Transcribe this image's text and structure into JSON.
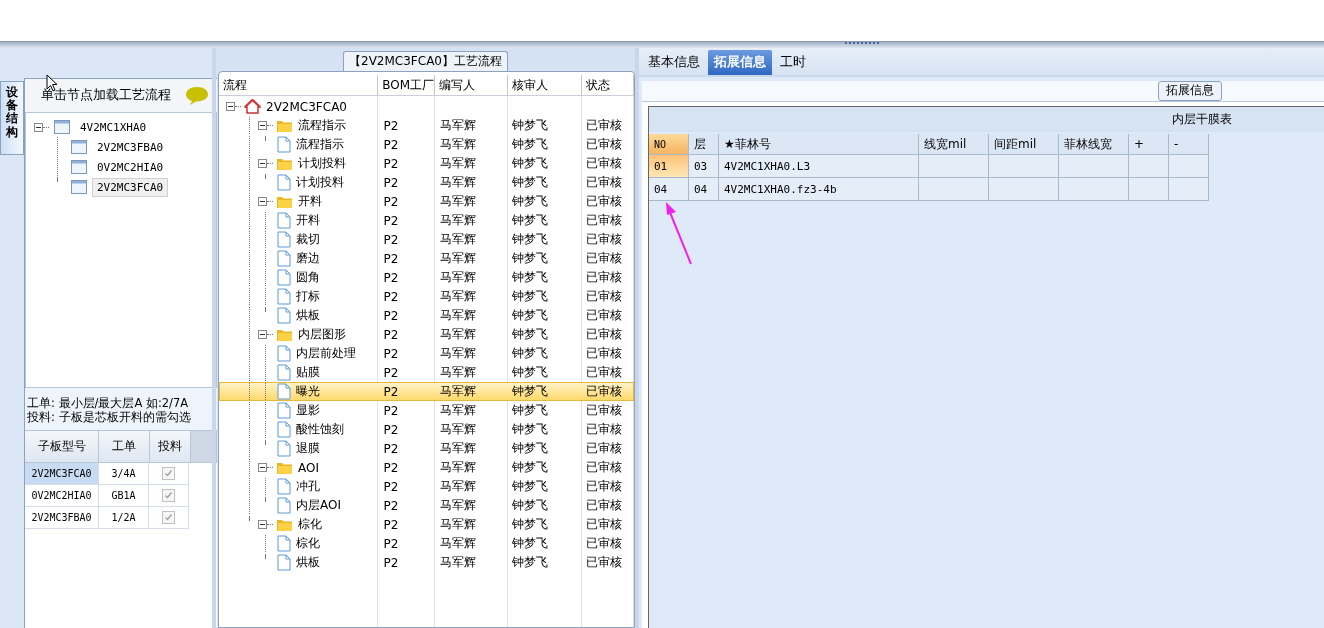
{
  "side_tab": {
    "label": "设备结构"
  },
  "left_panel": {
    "hint": "单击节点加载工艺流程",
    "tree": [
      {
        "label": "4V2MC1XHA0",
        "selected": false,
        "expanded": true,
        "children": [
          {
            "label": "2V2MC3FBA0",
            "selected": false
          },
          {
            "label": "0V2MC2HIA0",
            "selected": false
          },
          {
            "label": "2V2MC3FCA0",
            "selected": true
          }
        ]
      }
    ],
    "notes": [
      "工单: 最小层/最大层A 如:2/7A",
      "投料: 子板是芯板开料的需勾选"
    ],
    "grid": {
      "columns": [
        "子板型号",
        "工单",
        "投料"
      ],
      "rows": [
        {
          "model": "2V2MC3FCA0",
          "order": "3/4A",
          "checked": true,
          "selected": true
        },
        {
          "model": "0V2MC2HIA0",
          "order": "GB1A",
          "checked": true,
          "selected": false
        },
        {
          "model": "2V2MC3FBA0",
          "order": "1/2A",
          "checked": true,
          "selected": false
        }
      ]
    }
  },
  "flow_panel": {
    "title": "【2V2MC3FCA0】工艺流程",
    "columns": [
      "流程",
      "BOM工厂",
      "编写人",
      "核审人",
      "状态"
    ],
    "tree": [
      {
        "label": "2V2MC3FCA0",
        "kind": "root",
        "expanded": true,
        "children": [
          {
            "label": "流程指示",
            "kind": "folder",
            "expanded": true,
            "bom": "P2",
            "writer": "马军辉",
            "reviewer": "钟梦飞",
            "status": "已审核",
            "selected": false,
            "children": [
              {
                "label": "流程指示",
                "kind": "step",
                "bom": "P2",
                "writer": "马军辉",
                "reviewer": "钟梦飞",
                "status": "已审核",
                "selected": false
              }
            ]
          },
          {
            "label": "计划投料",
            "kind": "folder",
            "expanded": true,
            "bom": "P2",
            "writer": "马军辉",
            "reviewer": "钟梦飞",
            "status": "已审核",
            "selected": false,
            "children": [
              {
                "label": "计划投料",
                "kind": "step",
                "bom": "P2",
                "writer": "马军辉",
                "reviewer": "钟梦飞",
                "status": "已审核",
                "selected": false
              }
            ]
          },
          {
            "label": "开料",
            "kind": "folder",
            "expanded": true,
            "bom": "P2",
            "writer": "马军辉",
            "reviewer": "钟梦飞",
            "status": "已审核",
            "selected": false,
            "children": [
              {
                "label": "开料",
                "kind": "step",
                "bom": "P2",
                "writer": "马军辉",
                "reviewer": "钟梦飞",
                "status": "已审核",
                "selected": false
              },
              {
                "label": "裁切",
                "kind": "step",
                "bom": "P2",
                "writer": "马军辉",
                "reviewer": "钟梦飞",
                "status": "已审核",
                "selected": false
              },
              {
                "label": "磨边",
                "kind": "step",
                "bom": "P2",
                "writer": "马军辉",
                "reviewer": "钟梦飞",
                "status": "已审核",
                "selected": false
              },
              {
                "label": "圆角",
                "kind": "step",
                "bom": "P2",
                "writer": "马军辉",
                "reviewer": "钟梦飞",
                "status": "已审核",
                "selected": false
              },
              {
                "label": "打标",
                "kind": "step",
                "bom": "P2",
                "writer": "马军辉",
                "reviewer": "钟梦飞",
                "status": "已审核",
                "selected": false
              },
              {
                "label": "烘板",
                "kind": "step",
                "bom": "P2",
                "writer": "马军辉",
                "reviewer": "钟梦飞",
                "status": "已审核",
                "selected": false
              }
            ]
          },
          {
            "label": "内层图形",
            "kind": "folder",
            "expanded": true,
            "bom": "P2",
            "writer": "马军辉",
            "reviewer": "钟梦飞",
            "status": "已审核",
            "selected": false,
            "children": [
              {
                "label": "内层前处理",
                "kind": "step",
                "bom": "P2",
                "writer": "马军辉",
                "reviewer": "钟梦飞",
                "status": "已审核",
                "selected": false
              },
              {
                "label": "贴膜",
                "kind": "step",
                "bom": "P2",
                "writer": "马军辉",
                "reviewer": "钟梦飞",
                "status": "已审核",
                "selected": false
              },
              {
                "label": "曝光",
                "kind": "step",
                "bom": "P2",
                "writer": "马军辉",
                "reviewer": "钟梦飞",
                "status": "已审核",
                "selected": true
              },
              {
                "label": "显影",
                "kind": "step",
                "bom": "P2",
                "writer": "马军辉",
                "reviewer": "钟梦飞",
                "status": "已审核",
                "selected": false
              },
              {
                "label": "酸性蚀刻",
                "kind": "step",
                "bom": "P2",
                "writer": "马军辉",
                "reviewer": "钟梦飞",
                "status": "已审核",
                "selected": false
              },
              {
                "label": "退膜",
                "kind": "step",
                "bom": "P2",
                "writer": "马军辉",
                "reviewer": "钟梦飞",
                "status": "已审核",
                "selected": false
              }
            ]
          },
          {
            "label": "AOI",
            "kind": "folder",
            "expanded": true,
            "bom": "P2",
            "writer": "马军辉",
            "reviewer": "钟梦飞",
            "status": "已审核",
            "selected": false,
            "children": [
              {
                "label": "冲孔",
                "kind": "step",
                "bom": "P2",
                "writer": "马军辉",
                "reviewer": "钟梦飞",
                "status": "已审核",
                "selected": false
              },
              {
                "label": "内层AOI",
                "kind": "step",
                "bom": "P2",
                "writer": "马军辉",
                "reviewer": "钟梦飞",
                "status": "已审核",
                "selected": false
              }
            ]
          },
          {
            "label": "棕化",
            "kind": "folder",
            "expanded": true,
            "bom": "P2",
            "writer": "马军辉",
            "reviewer": "钟梦飞",
            "status": "已审核",
            "selected": false,
            "children": [
              {
                "label": "棕化",
                "kind": "step",
                "bom": "P2",
                "writer": "马军辉",
                "reviewer": "钟梦飞",
                "status": "已审核",
                "selected": false
              },
              {
                "label": "烘板",
                "kind": "step",
                "bom": "P2",
                "writer": "马军辉",
                "reviewer": "钟梦飞",
                "status": "已审核",
                "selected": false
              }
            ]
          }
        ]
      }
    ]
  },
  "detail_panel": {
    "tabs": [
      {
        "label": "基本信息",
        "selected": false
      },
      {
        "label": "拓展信息",
        "selected": true
      },
      {
        "label": "工时",
        "selected": false
      }
    ],
    "group_title": "拓展信息",
    "table": {
      "title": "内层干膜表",
      "columns": [
        "NO",
        "层",
        "★菲林号",
        "线宽mil",
        "间距mil",
        "菲林线宽",
        "+",
        "-"
      ],
      "rows": [
        {
          "cells": [
            "01",
            "03",
            "4V2MC1XHA0.L3",
            "",
            "",
            "",
            "",
            ""
          ],
          "selected": true
        },
        {
          "cells": [
            "04",
            "04",
            "4V2MC1XHA0.fz3-4b",
            "",
            "",
            "",
            "",
            ""
          ],
          "selected": false
        }
      ]
    }
  }
}
